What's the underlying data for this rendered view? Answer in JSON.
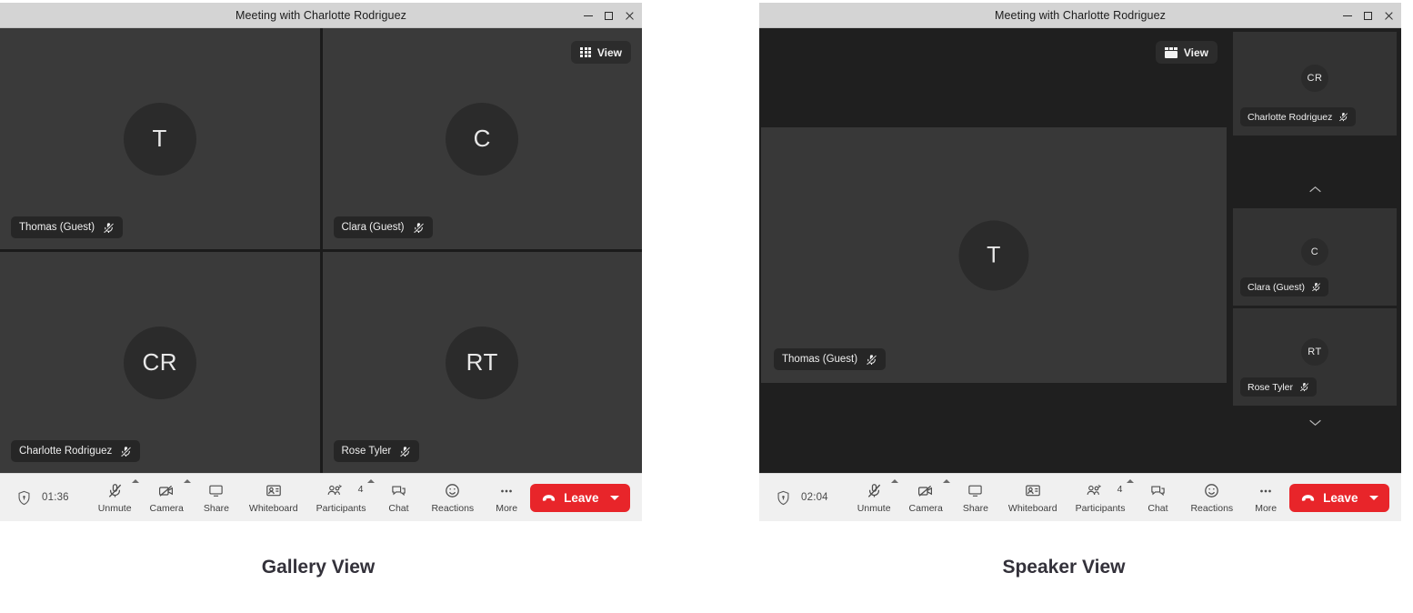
{
  "window": {
    "title": "Meeting with Charlotte Rodriguez",
    "controls": {
      "minimize": "minimize-button",
      "maximize": "maximize-button",
      "close": "close-button"
    }
  },
  "captions": {
    "gallery": "Gallery View",
    "speaker": "Speaker View"
  },
  "gallery_view": {
    "view_button": {
      "label": "View",
      "icon": "grid-icon"
    },
    "tiles": [
      {
        "initials": "T",
        "name": "Thomas (Guest)",
        "muted": true
      },
      {
        "initials": "C",
        "name": "Clara (Guest)",
        "muted": true
      },
      {
        "initials": "CR",
        "name": "Charlotte Rodriguez",
        "muted": true
      },
      {
        "initials": "RT",
        "name": "Rose Tyler",
        "muted": true
      }
    ],
    "toolbar": {
      "timer": "01:36",
      "items": [
        {
          "label": "Unmute",
          "icon": "mic-muted-icon",
          "has_caret": true
        },
        {
          "label": "Camera",
          "icon": "camera-off-icon",
          "has_caret": true
        },
        {
          "label": "Share",
          "icon": "screen-share-icon",
          "has_caret": false
        },
        {
          "label": "Whiteboard",
          "icon": "whiteboard-icon",
          "has_caret": false
        },
        {
          "label": "Participants",
          "icon": "participants-icon",
          "has_caret": true,
          "count": "4"
        },
        {
          "label": "Chat",
          "icon": "chat-icon",
          "has_caret": false
        },
        {
          "label": "Reactions",
          "icon": "reactions-icon",
          "has_caret": false
        },
        {
          "label": "More",
          "icon": "more-icon",
          "has_caret": false
        }
      ],
      "leave_label": "Leave"
    }
  },
  "speaker_view": {
    "view_button": {
      "label": "View",
      "icon": "speaker-layout-icon"
    },
    "active_speaker": {
      "initials": "T",
      "name": "Thomas (Guest)",
      "muted": true
    },
    "scroll_up": "scroll-up-arrow",
    "scroll_down": "scroll-down-arrow",
    "thumbnails": [
      {
        "initials": "CR",
        "name": "Charlotte Rodriguez",
        "muted": true
      },
      {
        "initials": "C",
        "name": "Clara (Guest)",
        "muted": true
      },
      {
        "initials": "RT",
        "name": "Rose Tyler",
        "muted": true
      }
    ],
    "toolbar": {
      "timer": "02:04",
      "items": [
        {
          "label": "Unmute",
          "icon": "mic-muted-icon",
          "has_caret": true
        },
        {
          "label": "Camera",
          "icon": "camera-off-icon",
          "has_caret": true
        },
        {
          "label": "Share",
          "icon": "screen-share-icon",
          "has_caret": false
        },
        {
          "label": "Whiteboard",
          "icon": "whiteboard-icon",
          "has_caret": false
        },
        {
          "label": "Participants",
          "icon": "participants-icon",
          "has_caret": true,
          "count": "4"
        },
        {
          "label": "Chat",
          "icon": "chat-icon",
          "has_caret": false
        },
        {
          "label": "Reactions",
          "icon": "reactions-icon",
          "has_caret": false
        },
        {
          "label": "More",
          "icon": "more-icon",
          "has_caret": false
        }
      ],
      "leave_label": "Leave"
    }
  },
  "colors": {
    "leave_red": "#e8252a",
    "toolbar_bg": "#f0f0f0",
    "titlebar_bg": "#d4d4d4",
    "tile_bg": "#3a3a3a",
    "avatar_bg": "#2b2b2b"
  }
}
